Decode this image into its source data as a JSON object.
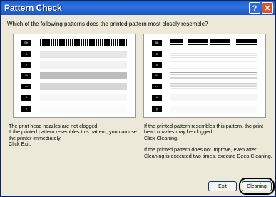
{
  "window": {
    "title": "Pattern Check"
  },
  "titlebar_buttons": {
    "help": "?",
    "close": "✕"
  },
  "question": "Which of the following patterns does the printed pattern most closely resemble?",
  "nozzle_labels": [
    "BK",
    "C",
    "c",
    "M",
    "m",
    "Y",
    "y"
  ],
  "left_desc": [
    "The print head nozzles are not clogged.",
    "If the printed pattern resembles this pattern, you can use the printer immediately.",
    "Click Exit."
  ],
  "right_desc": [
    "If the printed pattern resembles this pattern, the print head nozzles may be clogged.",
    "Click Cleaning.",
    "If the printed pattern does not improve, even after Cleaning is executed two times, execute Deep Cleaning."
  ],
  "buttons": {
    "exit": "Exit",
    "cleaning": "Cleaning"
  }
}
